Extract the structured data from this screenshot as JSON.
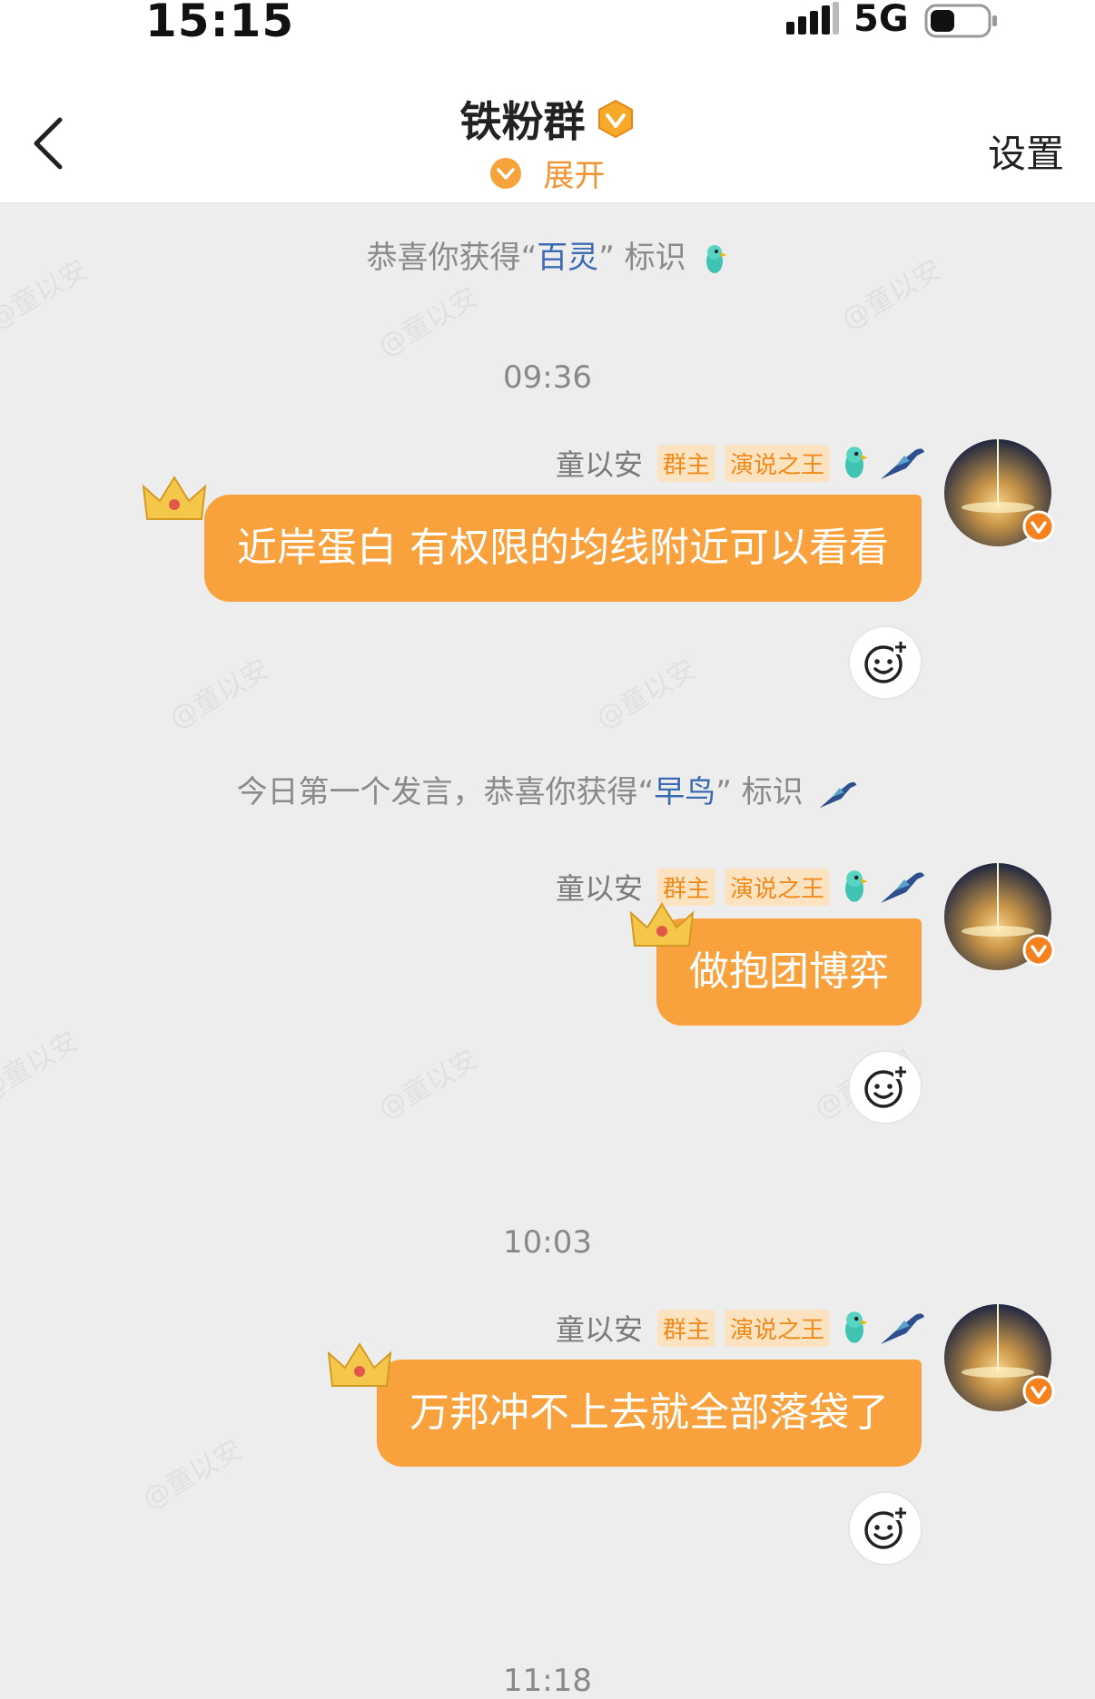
{
  "status_bar": {
    "time": "15:15",
    "network": "5G"
  },
  "nav": {
    "title": "铁粉群",
    "expand_label": "展开",
    "settings_label": "设置"
  },
  "watermark": "@童以安",
  "notices": [
    {
      "pre": "恭喜你获得",
      "highlight": "百灵",
      "post": "标识",
      "icon": "parrot-icon"
    },
    {
      "pre": "今日第一个发言，恭喜你获得",
      "highlight": "早鸟",
      "post": "标识",
      "icon": "bird-icon"
    }
  ],
  "timestamps": [
    "09:36",
    "10:03",
    "11:18"
  ],
  "messages": [
    {
      "sender": "童以安",
      "tags": [
        "群主",
        "演说之王"
      ],
      "text": "近岸蛋白 有权限的均线附近可以看看"
    },
    {
      "sender": "童以安",
      "tags": [
        "群主",
        "演说之王"
      ],
      "text": "做抱团博弈"
    },
    {
      "sender": "童以安",
      "tags": [
        "群主",
        "演说之王"
      ],
      "text": "万邦冲不上去就全部落袋了"
    }
  ],
  "colors": {
    "accent": "#f29330",
    "bubble": "#f9a13c",
    "highlight": "#3b6bb3",
    "background": "#ededed"
  }
}
